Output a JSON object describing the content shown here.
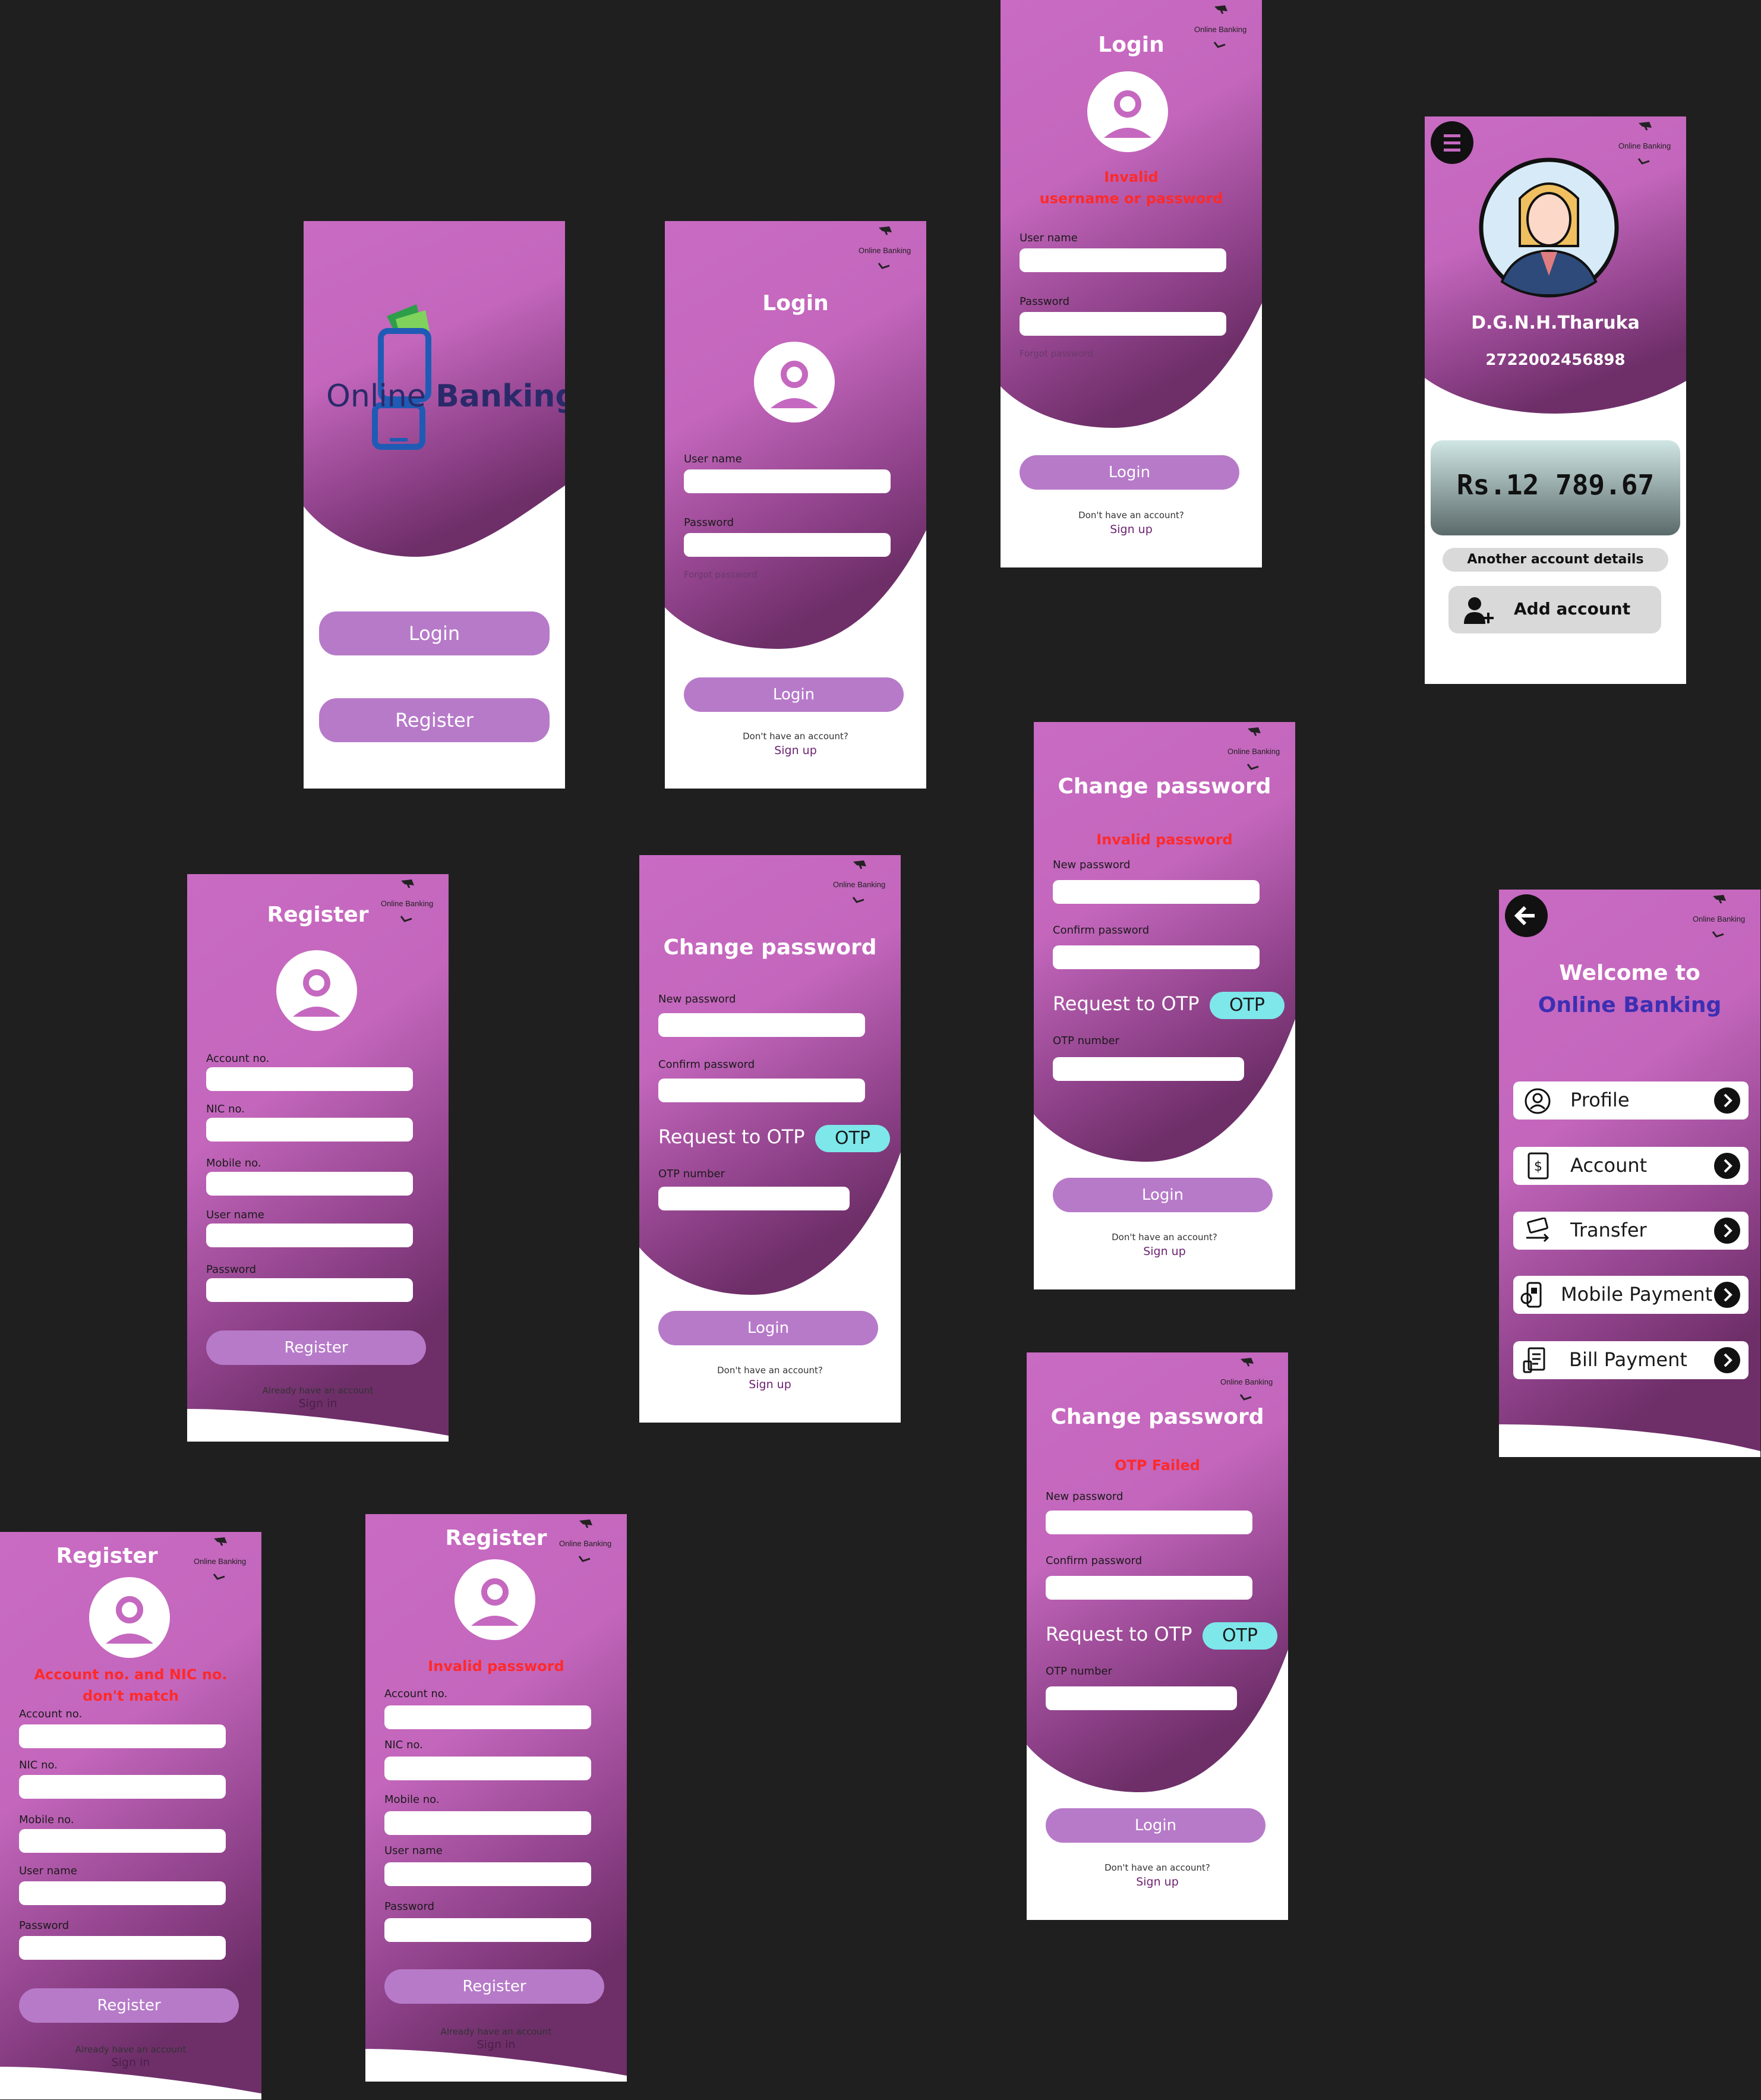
{
  "brand": {
    "name_part1": "Online ",
    "name_part2": "Banking",
    "mini_label": "Online Banking"
  },
  "splash": {
    "login_label": "Login",
    "register_label": "Register"
  },
  "login": {
    "title": "Login",
    "username_label": "User name",
    "password_label": "Password",
    "forgot_label": "Forgot password",
    "login_button": "Login",
    "no_account": "Don't have an account?",
    "signup_link": "Sign up",
    "error_line1": "Invalid",
    "error_line2": "username or password"
  },
  "register": {
    "title": "Register",
    "account_label": "Account no.",
    "nic_label": "NIC no.",
    "mobile_label": "Mobile no.",
    "username_label": "User name",
    "password_label": "Password",
    "register_button": "Register",
    "have_account": "Already have an account",
    "signin_link": "Sign in",
    "error_mismatch_line1": "Account no. and NIC no.",
    "error_mismatch_line2": "don't match",
    "error_password": "Invalid password"
  },
  "change_password": {
    "title": "Change password",
    "new_label": "New password",
    "confirm_label": "Confirm password",
    "request_otp": "Request to OTP",
    "otp_button": "OTP",
    "otp_number_label": "OTP number",
    "login_button": "Login",
    "no_account": "Don't have an account?",
    "signup_link": "Sign up",
    "error_invalid": "Invalid password",
    "error_otp": "OTP Failed"
  },
  "profile": {
    "name": "D.G.N.H.Tharuka",
    "nic": "2722002456898",
    "balance": "Rs.12 789.67",
    "another_account": "Another account details",
    "add_account": "Add account"
  },
  "home": {
    "welcome_line1": "Welcome to",
    "welcome_line2": "Online Banking",
    "menu": [
      {
        "label": "Profile",
        "icon": "profile-icon"
      },
      {
        "label": "Account",
        "icon": "account-book-icon"
      },
      {
        "label": "Transfer",
        "icon": "money-transfer-icon"
      },
      {
        "label": "Mobile Payment",
        "icon": "mobile-payment-icon"
      },
      {
        "label": "Bill Payment",
        "icon": "bill-icon"
      }
    ]
  },
  "colors": {
    "purple": "#c568c0",
    "dark_purple": "#7b3a76",
    "button": "#b77ac9",
    "otp": "#7de7ea",
    "error": "#ff2a2a",
    "welcome_blue": "#3b2fb3"
  }
}
